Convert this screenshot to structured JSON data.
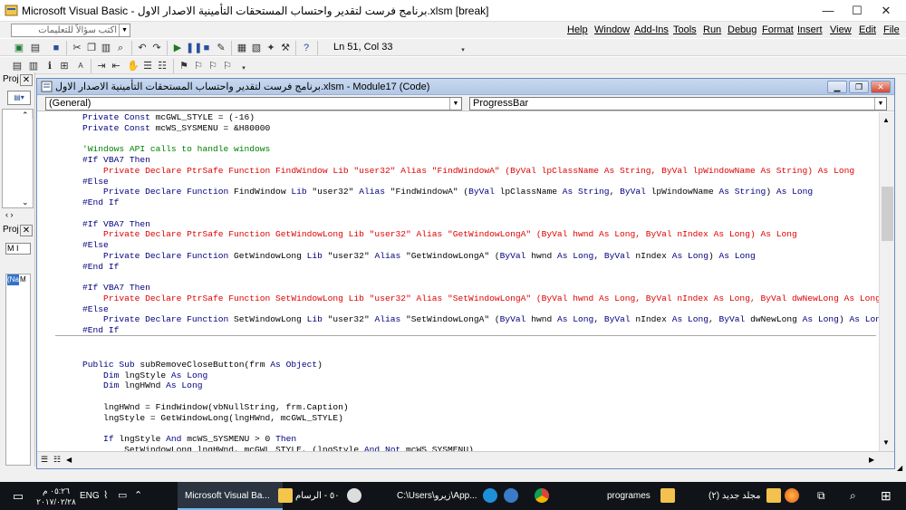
{
  "window": {
    "title": "Microsoft Visual Basic - برنامج فرست لتقدير واحتساب المستحقات التأمينية الاصدار الاول.xlsm [break]",
    "minimize": "—",
    "maximize": "☐",
    "close": "✕"
  },
  "help_box": {
    "placeholder": "اكتب سؤالاً للتعليمات"
  },
  "menu": [
    "Help",
    "Window",
    "Add-Ins",
    "Tools",
    "Run",
    "Debug",
    "Format",
    "Insert",
    "View",
    "Edit",
    "File"
  ],
  "status": {
    "cursor_position": "Ln 51, Col 33"
  },
  "left_panel": {
    "project_label": "Proj",
    "project_label2": "Proj",
    "name_label": "(Na",
    "name_value": "M",
    "props_combo": "M I"
  },
  "code_window": {
    "title": "برنامج فرست لتقدير واحتساب المستحقات التأمينية الاصدار الاول.xlsm - Module17 (Code)",
    "object_combo": "(General)",
    "procedure_combo": "ProgressBar",
    "lines_top": [
      [
        [
          "k",
          "    Private Const "
        ],
        [
          "n",
          "mcGWL_STYLE = (-16)"
        ]
      ],
      [
        [
          "k",
          "    Private Const "
        ],
        [
          "n",
          "mcWS_SYSMENU = &H80000"
        ]
      ],
      [
        [
          "n",
          ""
        ]
      ],
      [
        [
          "c",
          "    'Windows API calls to handle windows"
        ]
      ],
      [
        [
          "k",
          "    #If VBA7 Then"
        ]
      ],
      [
        [
          "e",
          "        Private Declare PtrSafe Function FindWindow Lib \"user32\" Alias \"FindWindowA\" (ByVal lpClassName As String, ByVal lpWindowName As String) As Long"
        ]
      ],
      [
        [
          "k",
          "    #Else"
        ]
      ],
      [
        [
          "k",
          "        Private Declare Function "
        ],
        [
          "n",
          "FindWindow "
        ],
        [
          "k",
          "Lib "
        ],
        [
          "n",
          "\"user32\" "
        ],
        [
          "k",
          "Alias "
        ],
        [
          "n",
          "\"FindWindowA\" ("
        ],
        [
          "k",
          "ByVal "
        ],
        [
          "n",
          "lpClassName "
        ],
        [
          "k",
          "As String"
        ],
        [
          "n",
          ", "
        ],
        [
          "k",
          "ByVal "
        ],
        [
          "n",
          "lpWindowName "
        ],
        [
          "k",
          "As String"
        ],
        [
          "n",
          ") "
        ],
        [
          "k",
          "As Long"
        ]
      ],
      [
        [
          "k",
          "    #End If"
        ]
      ],
      [
        [
          "n",
          ""
        ]
      ],
      [
        [
          "k",
          "    #If VBA7 Then"
        ]
      ],
      [
        [
          "e",
          "        Private Declare PtrSafe Function GetWindowLong Lib \"user32\" Alias \"GetWindowLongA\" (ByVal hwnd As Long, ByVal nIndex As Long) As Long"
        ]
      ],
      [
        [
          "k",
          "    #Else"
        ]
      ],
      [
        [
          "k",
          "        Private Declare Function "
        ],
        [
          "n",
          "GetWindowLong "
        ],
        [
          "k",
          "Lib "
        ],
        [
          "n",
          "\"user32\" "
        ],
        [
          "k",
          "Alias "
        ],
        [
          "n",
          "\"GetWindowLongA\" ("
        ],
        [
          "k",
          "ByVal "
        ],
        [
          "n",
          "hwnd "
        ],
        [
          "k",
          "As Long"
        ],
        [
          "n",
          ", "
        ],
        [
          "k",
          "ByVal "
        ],
        [
          "n",
          "nIndex "
        ],
        [
          "k",
          "As Long"
        ],
        [
          "n",
          ") "
        ],
        [
          "k",
          "As Long"
        ]
      ],
      [
        [
          "k",
          "    #End If"
        ]
      ],
      [
        [
          "n",
          ""
        ]
      ],
      [
        [
          "k",
          "    #If VBA7 Then"
        ]
      ],
      [
        [
          "e",
          "        Private Declare PtrSafe Function SetWindowLong Lib \"user32\" Alias \"SetWindowLongA\" (ByVal hwnd As Long, ByVal nIndex As Long, ByVal dwNewLong As Long)_"
        ]
      ],
      [
        [
          "k",
          "    #Else"
        ]
      ],
      [
        [
          "k",
          "        Private Declare Function "
        ],
        [
          "n",
          "SetWindowLong "
        ],
        [
          "k",
          "Lib "
        ],
        [
          "n",
          "\"user32\" "
        ],
        [
          "k",
          "Alias "
        ],
        [
          "n",
          "\"SetWindowLongA\" ("
        ],
        [
          "k",
          "ByVal "
        ],
        [
          "n",
          "hwnd "
        ],
        [
          "k",
          "As Long"
        ],
        [
          "n",
          ", "
        ],
        [
          "k",
          "ByVal "
        ],
        [
          "n",
          "nIndex "
        ],
        [
          "k",
          "As Long"
        ],
        [
          "n",
          ", "
        ],
        [
          "k",
          "ByVal "
        ],
        [
          "n",
          "dwNewLong "
        ],
        [
          "k",
          "As Long"
        ],
        [
          "n",
          ") "
        ],
        [
          "k",
          "As Long"
        ]
      ],
      [
        [
          "k",
          "    #End If"
        ]
      ]
    ],
    "lines_bottom": [
      [
        [
          "k",
          "    Public Sub "
        ],
        [
          "n",
          "subRemoveCloseButton(frm "
        ],
        [
          "k",
          "As Object"
        ],
        [
          "n",
          ")"
        ]
      ],
      [
        [
          "k",
          "        Dim "
        ],
        [
          "n",
          "lngStyle "
        ],
        [
          "k",
          "As Long"
        ]
      ],
      [
        [
          "k",
          "        Dim "
        ],
        [
          "n",
          "lngHWnd "
        ],
        [
          "k",
          "As Long"
        ]
      ],
      [
        [
          "n",
          ""
        ]
      ],
      [
        [
          "n",
          "        lngHWnd = FindWindow(vbNullString, frm.Caption)"
        ]
      ],
      [
        [
          "n",
          "        lngStyle = GetWindowLong(lngHWnd, mcGWL_STYLE)"
        ]
      ],
      [
        [
          "n",
          ""
        ]
      ],
      [
        [
          "k",
          "        If "
        ],
        [
          "n",
          "lngStyle "
        ],
        [
          "k",
          "And "
        ],
        [
          "n",
          "mcWS_SYSMENU > 0 "
        ],
        [
          "k",
          "Then"
        ]
      ],
      [
        [
          "n",
          "            SetWindowLong lngHWnd, mcGWL_STYLE, (lngStyle "
        ],
        [
          "k",
          "And Not "
        ],
        [
          "n",
          "mcWS_SYSMENU)"
        ]
      ]
    ]
  },
  "taskbar": {
    "time": "٠٥:٢٦ م",
    "date": "٢٠١٧/٠٢/٢٨",
    "lang": "ENG",
    "items": [
      {
        "label": "Microsoft Visual Ba..."
      },
      {
        "label": "٥٠ - الرسام"
      },
      {
        "label": "C:\\Users\\زيرو\\App..."
      },
      {
        "label": ""
      },
      {
        "label": ""
      },
      {
        "label": "programes"
      },
      {
        "label": "مجلد جديد (٢)"
      }
    ]
  },
  "colors": {
    "keyword": "#00007f",
    "comment": "#008000",
    "error": "#e00000",
    "accent": "#76b9ed"
  }
}
